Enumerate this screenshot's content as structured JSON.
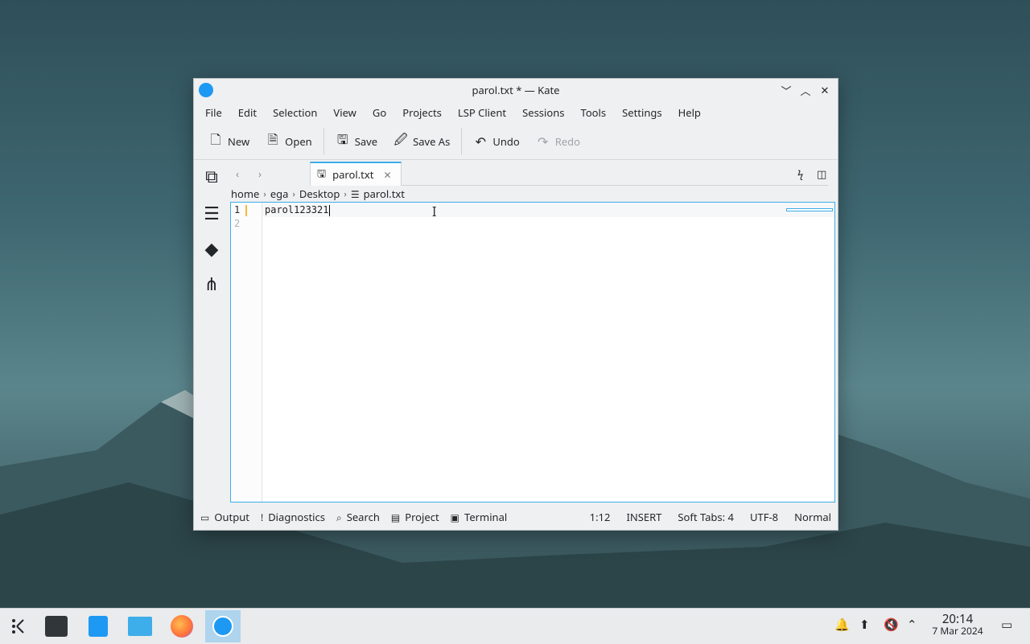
{
  "window": {
    "title": "parol.txt * — Kate"
  },
  "menu": [
    "File",
    "Edit",
    "Selection",
    "View",
    "Go",
    "Projects",
    "LSP Client",
    "Sessions",
    "Tools",
    "Settings",
    "Help"
  ],
  "toolbar": {
    "new": "New",
    "open": "Open",
    "save": "Save",
    "save_as": "Save As",
    "undo": "Undo",
    "redo": "Redo"
  },
  "tab": {
    "label": "parol.txt"
  },
  "breadcrumb": [
    "home",
    "ega",
    "Desktop",
    "parol.txt"
  ],
  "editor": {
    "lines": [
      "1",
      "2"
    ],
    "content": "parol123321"
  },
  "statusbar": {
    "left": [
      "Output",
      "Diagnostics",
      "Search",
      "Project",
      "Terminal"
    ],
    "position": "1:12",
    "mode": "INSERT",
    "tabs": "Soft Tabs: 4",
    "encoding": "UTF-8",
    "syntax": "Normal"
  },
  "taskbar": {
    "time": "20:14",
    "date": "7 Mar 2024"
  }
}
